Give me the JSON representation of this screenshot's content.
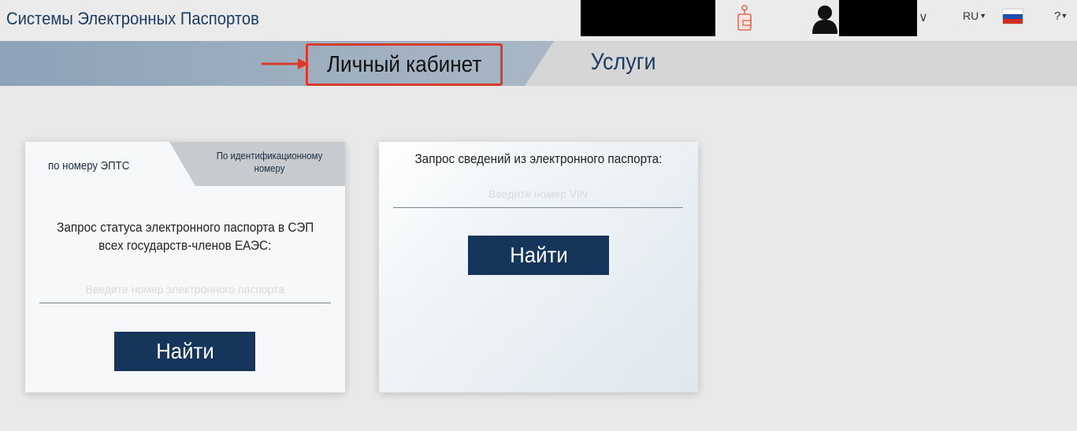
{
  "header": {
    "app_title": "Системы Электронных Паспортов",
    "lang_label": "RU",
    "icons": [
      "wallet-icon",
      "user-icon",
      "chevron-down-icon",
      "russia-flag-icon",
      "help-icon"
    ],
    "colors": {
      "brand": "#1c3d63",
      "highlight": "#d73c2c"
    }
  },
  "nav": {
    "personal_cabinet": "Личный кабинет",
    "services": "Услуги"
  },
  "left_card": {
    "tab_by_number": "по номеру ЭПТС",
    "tab_by_id": "По идентификационному номеру",
    "heading_line1": "Запрос статуса электронного паспорта в СЭП",
    "heading_line2": "всех государств-членов ЕАЭС:",
    "input_placeholder": "Введите номер электронного паспорта",
    "button_label": "Найти"
  },
  "right_card": {
    "heading": "Запрос сведений из электронного паспорта:",
    "input_placeholder": "Введите номер VIN",
    "button_label": "Найти"
  }
}
